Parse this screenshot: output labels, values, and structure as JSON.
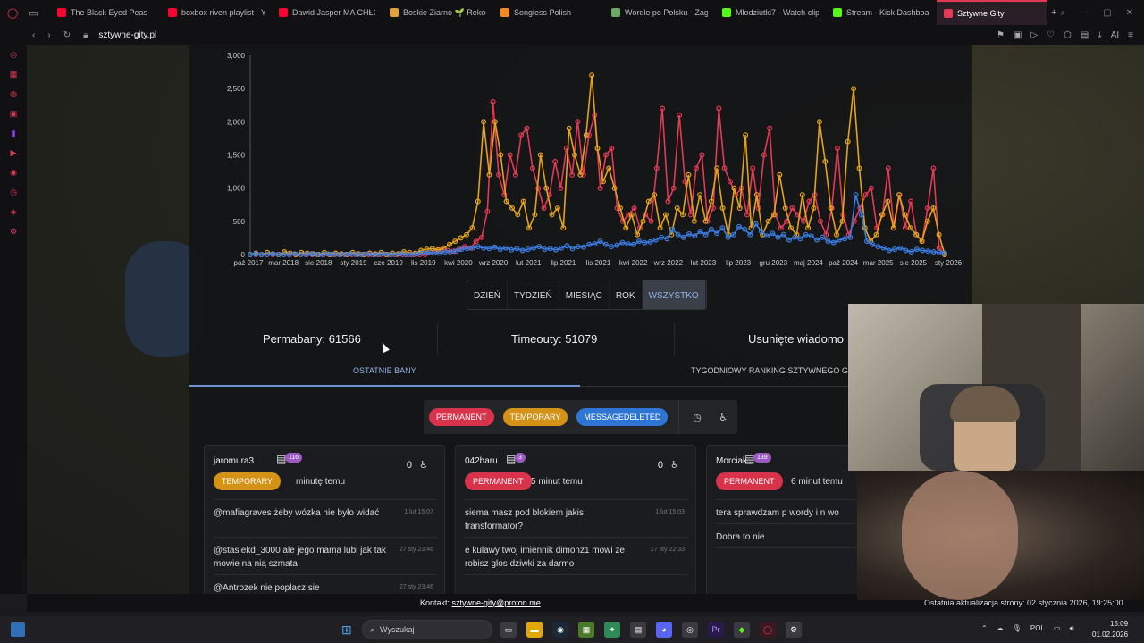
{
  "browser": {
    "tabs": [
      {
        "label": "The Black Eyed Peas",
        "fav_color": "#ff0033"
      },
      {
        "label": "boxbox riven playlist - Yo",
        "fav_color": "#ff0033"
      },
      {
        "label": "Dawid Jasper MA CHŁOP",
        "fav_color": "#ff0033"
      },
      {
        "label": "Boskie Ziarno 🌱 Rekord",
        "fav_color": "#e0a040"
      },
      {
        "label": "Songless Polish",
        "fav_color": "#f08a24"
      },
      {
        "label": "Wordle po Polsku - Zagr",
        "fav_color": "#6aaa64"
      },
      {
        "label": "Młodziutki7 - Watch clip",
        "fav_color": "#53fc18"
      },
      {
        "label": "Stream - Kick Dashboard",
        "fav_color": "#53fc18"
      },
      {
        "label": "Sztywne Gity",
        "fav_color": "#e23a55",
        "active": true
      }
    ],
    "url": "sztywne-gity.pl",
    "ai_label": "AI"
  },
  "chart_data": {
    "type": "line",
    "x_tick_labels": [
      "paź 2017",
      "mar 2018",
      "sie 2018",
      "sty 2019",
      "cze 2019",
      "lis 2019",
      "kwi 2020",
      "wrz 2020",
      "lut 2021",
      "lip 2021",
      "lis 2021",
      "kwi 2022",
      "wrz 2022",
      "lut 2023",
      "lip 2023",
      "gru 2023",
      "maj 2024",
      "paź 2024",
      "mar 2025",
      "sie 2025",
      "sty 2026"
    ],
    "y_tick_labels": [
      "0",
      "500",
      "1,000",
      "1,500",
      "2,000",
      "2,500",
      "3,000"
    ],
    "ylim": [
      0,
      3000
    ],
    "grid": false,
    "series": [
      {
        "color": "#e23a55",
        "values": [
          0,
          0,
          0,
          0,
          0,
          0,
          0,
          0,
          0,
          0,
          0,
          0,
          0,
          0,
          0,
          0,
          0,
          0,
          0,
          0,
          0,
          0,
          0,
          0,
          0,
          0,
          0,
          0,
          0,
          0,
          0,
          0,
          30,
          60,
          80,
          60,
          50,
          80,
          120,
          100,
          200,
          260,
          650,
          2300,
          1200,
          900,
          1500,
          1200,
          1800,
          1900,
          1300,
          1000,
          700,
          900,
          1400,
          1000,
          1600,
          1200,
          2000,
          1200,
          1800,
          2100,
          1000,
          1500,
          1600,
          700,
          500,
          600,
          700,
          400,
          600,
          500,
          1300,
          2200,
          800,
          1000,
          2100,
          1100,
          600,
          1300,
          1500,
          500,
          700,
          2200,
          1300,
          1100,
          900,
          1000,
          600,
          1300,
          700,
          1500,
          1900,
          600,
          400,
          500,
          700,
          600,
          500,
          800,
          900,
          500,
          300,
          700,
          1600,
          600,
          300,
          500,
          700,
          900,
          1000,
          400,
          600,
          1300,
          400,
          900,
          400,
          800,
          300,
          200,
          700,
          1300,
          100,
          0
        ]
      },
      {
        "color": "#e3a21a",
        "values": [
          0,
          20,
          0,
          30,
          10,
          0,
          40,
          20,
          0,
          30,
          20,
          10,
          0,
          30,
          0,
          20,
          10,
          0,
          30,
          10,
          0,
          20,
          10,
          30,
          0,
          20,
          10,
          40,
          30,
          20,
          60,
          80,
          90,
          70,
          100,
          150,
          200,
          250,
          300,
          400,
          800,
          2000,
          1200,
          2000,
          1500,
          800,
          700,
          600,
          800,
          400,
          600,
          1500,
          1000,
          600,
          700,
          400,
          1900,
          1500,
          1200,
          1800,
          2700,
          1600,
          1100,
          1300,
          1000,
          700,
          400,
          600,
          300,
          500,
          800,
          900,
          400,
          600,
          300,
          700,
          600,
          1200,
          500,
          900,
          500,
          800,
          1300,
          700,
          300,
          1000,
          700,
          1800,
          400,
          900,
          300,
          500,
          600,
          1200,
          700,
          400,
          300,
          900,
          400,
          700,
          2000,
          1400,
          700,
          300,
          500,
          1700,
          2500,
          1300,
          400,
          200,
          300,
          600,
          800,
          400,
          900,
          600,
          400,
          300,
          200,
          500,
          700,
          300,
          0
        ]
      },
      {
        "color": "#3a7de0",
        "values": [
          0,
          10,
          0,
          0,
          10,
          0,
          0,
          0,
          10,
          0,
          0,
          10,
          0,
          0,
          10,
          0,
          0,
          0,
          10,
          0,
          0,
          10,
          0,
          0,
          10,
          0,
          0,
          10,
          0,
          0,
          10,
          20,
          30,
          20,
          20,
          40,
          40,
          50,
          80,
          90,
          100,
          120,
          100,
          90,
          110,
          80,
          100,
          70,
          90,
          60,
          80,
          100,
          120,
          80,
          90,
          70,
          100,
          130,
          90,
          120,
          110,
          150,
          160,
          200,
          150,
          120,
          140,
          180,
          160,
          150,
          200,
          180,
          190,
          220,
          260,
          240,
          380,
          300,
          260,
          310,
          280,
          350,
          300,
          380,
          320,
          400,
          260,
          300,
          420,
          380,
          300,
          460,
          350,
          280,
          320,
          260,
          300,
          220,
          260,
          240,
          300,
          280,
          220,
          260,
          200,
          180,
          220,
          240,
          260,
          900,
          600,
          200,
          150,
          120,
          100,
          60,
          80,
          100,
          60,
          40,
          80,
          60,
          50,
          40,
          30,
          20
        ]
      }
    ]
  },
  "range_buttons": [
    "DZIEŃ",
    "TYDZIEŃ",
    "MIESIĄC",
    "ROK",
    "WSZYSTKO"
  ],
  "range_active": "WSZYSTKO",
  "stats": {
    "permabany": "Permabany: 61566",
    "timeouty": "Timeouty: 51079",
    "usuniete": "Usunięte wiadomo"
  },
  "subtabs": {
    "recent": "OSTATNIE BANY",
    "ranking": "TYGODNIOWY RANKING SZTYWNEGO G"
  },
  "filters": {
    "permanent": "PERMANENT",
    "temporary": "TEMPORARY",
    "messagedeleted": "MESSAGEDELETED",
    "colors": {
      "permanent": "#d8334a",
      "temporary": "#d49316",
      "messagedeleted": "#2f75d6"
    }
  },
  "cards": [
    {
      "user": "jaromura3",
      "count": "116",
      "score": "0",
      "type": "TEMPORARY",
      "type_color": "#d49316",
      "ago": "minutę temu",
      "messages": [
        {
          "text": "@mafiagraves żeby wózka nie było widać",
          "ts": "1 lut 15:07"
        },
        {
          "text": "@stasiekd_3000 ale jego mama lubi jak tak mowie na nią szmata",
          "ts": "27 sty 23:46"
        },
        {
          "text": "@Antrozek nie poplacz sie",
          "ts": "27 sty 23:46"
        }
      ]
    },
    {
      "user": "042haru",
      "count": "3",
      "score": "0",
      "type": "PERMANENT",
      "type_color": "#d8334a",
      "ago": "5 minut temu",
      "messages": [
        {
          "text": "siema masz pod blokiem jakis transformator?",
          "ts": "1 lut 15:03"
        },
        {
          "text": "e kulawy twoj imiennik dimonz1 mowi ze robisz glos dziwki za darmo",
          "ts": "27 sty 22:33"
        }
      ]
    },
    {
      "user": "Morciak",
      "count": "139",
      "score": "",
      "type": "PERMANENT",
      "type_color": "#d8334a",
      "ago": "6 minut temu",
      "messages": [
        {
          "text": "tera sprawdzam p wordy i n wo",
          "ts": ""
        },
        {
          "text": "Dobra to nie",
          "ts": ""
        }
      ]
    }
  ],
  "footer": {
    "contact_label": "Kontakt:",
    "contact_email": "sztywne-gity@proton.me",
    "update": "Ostatnia aktualizacja strony: 02 stycznia 2026, 19:25:00"
  },
  "taskbar": {
    "search_placeholder": "Wyszukaj",
    "lang": "POL",
    "time": "15:09",
    "date": "01.02.2026"
  }
}
